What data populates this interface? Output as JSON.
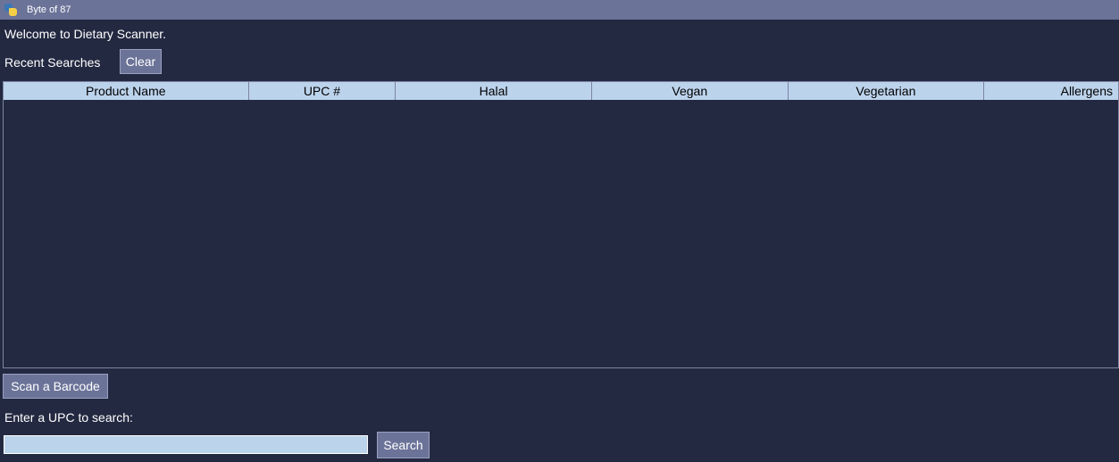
{
  "window": {
    "title": "Byte of 87",
    "icon": "python-icon"
  },
  "main": {
    "welcome": "Welcome to Dietary Scanner.",
    "recent_label": "Recent Searches",
    "clear_label": "Clear"
  },
  "table": {
    "columns": [
      "Product Name",
      "UPC #",
      "Halal",
      "Vegan",
      "Vegetarian",
      "Allergens"
    ],
    "rows": []
  },
  "scan": {
    "button_label": "Scan a Barcode"
  },
  "search": {
    "label": "Enter a UPC to search:",
    "value": "",
    "placeholder": "",
    "button_label": "Search"
  },
  "colors": {
    "background": "#232941",
    "titlebar": "#6b7398",
    "button": "#6b7398",
    "header": "#bcd3ec"
  }
}
